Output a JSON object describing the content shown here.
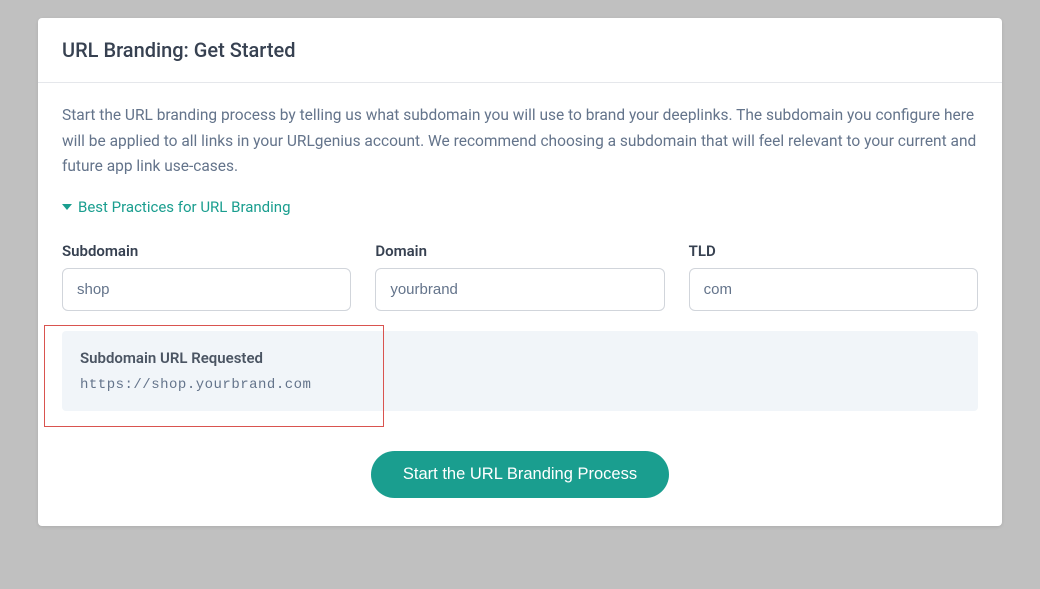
{
  "header": {
    "title": "URL Branding: Get Started"
  },
  "intro": "Start the URL branding process by telling us what subdomain you will use to brand your deeplinks. The subdomain you configure here will be applied to all links in your URLgenius account. We recommend choosing a subdomain that will feel relevant to your current and future app link use-cases.",
  "accordion": {
    "label": "Best Practices for URL Branding"
  },
  "fields": {
    "subdomain": {
      "label": "Subdomain",
      "value": "shop"
    },
    "domain": {
      "label": "Domain",
      "value": "yourbrand"
    },
    "tld": {
      "label": "TLD",
      "value": "com"
    }
  },
  "result": {
    "title": "Subdomain URL Requested",
    "url": "https://shop.yourbrand.com"
  },
  "action": {
    "start_label": "Start the URL Branding Process"
  },
  "colors": {
    "accent": "#1a9e8f",
    "highlight_border": "#d9534f"
  }
}
